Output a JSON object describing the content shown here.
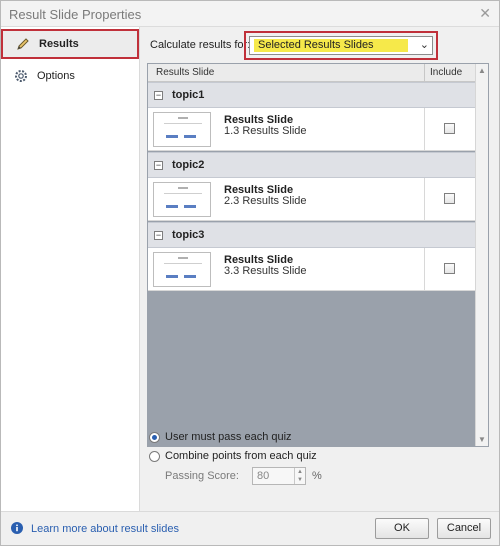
{
  "window": {
    "title": "Result Slide Properties"
  },
  "sidebar": {
    "items": [
      {
        "label": "Results",
        "icon": "pencil-icon",
        "active": true
      },
      {
        "label": "Options",
        "icon": "gear-icon",
        "active": false
      }
    ]
  },
  "calc": {
    "label": "Calculate results for:",
    "value": "Selected Results Slides"
  },
  "table": {
    "headers": {
      "slide": "Results Slide",
      "include": "Include"
    },
    "groups": [
      {
        "name": "topic1",
        "slide_title": "Results Slide",
        "slide_sub": "1.3 Results Slide",
        "include": false
      },
      {
        "name": "topic2",
        "slide_title": "Results Slide",
        "slide_sub": "2.3 Results Slide",
        "include": false
      },
      {
        "name": "topic3",
        "slide_title": "Results Slide",
        "slide_sub": "3.3 Results Slide",
        "include": false
      }
    ]
  },
  "options": {
    "pass_each": "User must pass each quiz",
    "combine": "Combine points from each quiz",
    "selected": "pass_each",
    "passing_label": "Passing Score:",
    "passing_value": "80",
    "percent": "%"
  },
  "footer": {
    "learn_more": "Learn more about result slides",
    "ok": "OK",
    "cancel": "Cancel"
  },
  "colors": {
    "accent": "#c0303a",
    "highlight": "#f6e94a",
    "link": "#2a5fb0"
  }
}
